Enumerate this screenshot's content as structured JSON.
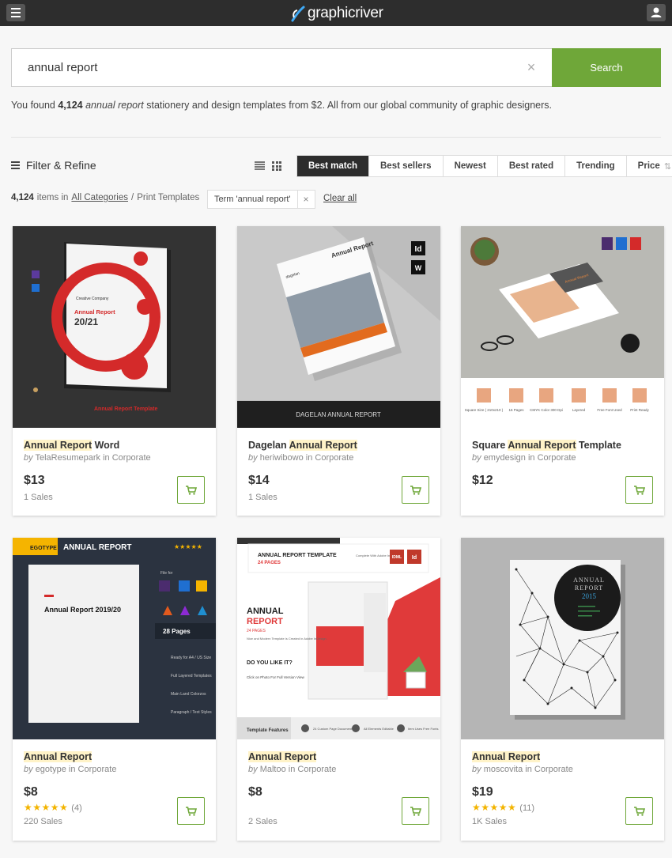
{
  "header": {
    "logo_text": "graphicriver",
    "menu_icon": "hamburger-icon",
    "user_icon": "user-icon"
  },
  "search": {
    "value": "annual report",
    "clear_label": "×",
    "button_label": "Search"
  },
  "results": {
    "prefix": "You found ",
    "count": "4,124",
    "term": "annual report",
    "suffix": " stationery and design templates from $2. All from our global community of graphic designers."
  },
  "toolbar": {
    "filter_label": "Filter & Refine",
    "sort_tabs": [
      "Best match",
      "Best sellers",
      "Newest",
      "Best rated",
      "Trending",
      "Price"
    ],
    "active_sort": "Best match"
  },
  "breadcrumb": {
    "count": "4,124",
    "items_in": "items in",
    "category": "All Categories",
    "separator": "/",
    "subcategory": "Print Templates",
    "term_chip": "Term 'annual report'",
    "chip_close": "×",
    "clear_all": "Clear all"
  },
  "items": [
    {
      "title_hl": "Annual Report",
      "title_rest": " Word",
      "author": "TelaResumepark",
      "in": "in",
      "category": "Corporate",
      "price": "$13",
      "sales": "1 Sales",
      "thumb": {
        "label": "Annual Report",
        "year": "20/21",
        "footer": "Annual Report Template",
        "brand": "Creative Company"
      }
    },
    {
      "title_pre": "Dagelan ",
      "title_hl": "Annual Report",
      "author": "heriwibowo",
      "in": "in",
      "category": "Corporate",
      "price": "$14",
      "sales": "1 Sales",
      "thumb": {
        "cover_title": "Annual Report",
        "cover_brand": "dagelan",
        "banner": "DAGELAN ANNUAL REPORT",
        "badge1": "Id",
        "badge2": "W"
      }
    },
    {
      "title_pre": "Square ",
      "title_hl": "Annual Report",
      "title_rest": " Template",
      "author": "emydesign",
      "in": "in",
      "category": "Corporate",
      "price": "$12",
      "thumb": {
        "cover_title": "Annual Report",
        "features": [
          "Square Size ( 210x210 )",
          "16 Pages",
          "CMYK Color 300 Dpi",
          "Layered",
          "Free Font Used",
          "Print Ready"
        ]
      }
    },
    {
      "title_hl": "Annual Report",
      "author": "egotype",
      "in": "in",
      "category": "Corporate",
      "price": "$8",
      "rating": "★★★★★",
      "reviews": "(4)",
      "sales": "220 Sales",
      "thumb": {
        "brand": "EGOTYPE",
        "banner": "ANNUAL REPORT",
        "stars": "★★★★★",
        "cover_title": "Annual Report 2019/20",
        "pages": "28 Pages",
        "features": [
          "Ready for A4 / US Size",
          "Full Layered Templates",
          "Main Land Colorzos",
          "Paragraph / Text Styles"
        ],
        "file_types": "File for"
      }
    },
    {
      "title_hl": "Annual Report",
      "author": "Maltoo",
      "in": "in",
      "category": "Corporate",
      "price": "$8",
      "sales": "2 Sales",
      "thumb": {
        "heading": "ANNUAL REPORT TEMPLATE",
        "heading_pages": "24 PAGES",
        "big1": "ANNUAL",
        "big2": "REPORT",
        "pages": "24 PAGES",
        "question": "DO YOU LIKE IT?",
        "cta": "Click on Photo For Full Version View",
        "body": "Nice and Modern Template is Created in Adobe InDesign.",
        "features_label": "Template Features",
        "feat": [
          "24 Custom Page Document",
          "All Elements Editable",
          "Item Uses Free Fonts"
        ],
        "note": "Complete With Adobe InDesign",
        "badge": "IDML",
        "badge2": "Id"
      }
    },
    {
      "title_hl": "Annual Report",
      "author": "moscovita",
      "in": "in",
      "category": "Corporate",
      "price": "$19",
      "rating": "★★★★★",
      "reviews": "(11)",
      "sales": "1K Sales",
      "thumb": {
        "circle_line1": "ANNUAL",
        "circle_line2": "REPORT",
        "circle_year": "2015"
      }
    }
  ],
  "by_label": "by",
  "colors": {
    "accent": "#6fa739",
    "topbar": "#2d2d2d",
    "highlight": "#fff3c8",
    "star": "#f3b400"
  },
  "icons": {
    "cart": "cart-icon",
    "filter": "filter-icon",
    "list_view": "list-view-icon",
    "grid_view": "grid-view-icon",
    "sort": "sort-arrows-icon"
  }
}
